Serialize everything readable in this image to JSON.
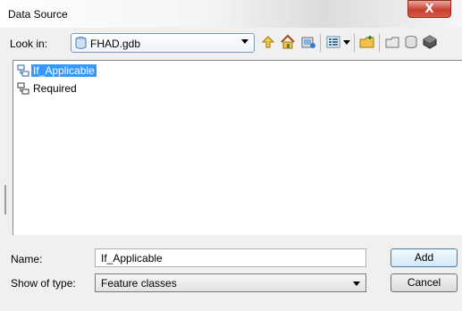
{
  "window": {
    "title": "Data Source",
    "close_glyph": "X"
  },
  "lookin": {
    "label": "Look in:",
    "value": "FHAD.gdb",
    "icon": "geodatabase-icon"
  },
  "toolbar": {
    "icons": [
      "up-one-level-icon",
      "home-icon",
      "catalog-connect-icon",
      "list-view-icon",
      "view-menu-arrow-icon",
      "new-folder-icon",
      "new-file-geodatabase-icon",
      "new-personal-geodatabase-icon",
      "arcsde-connection-icon"
    ]
  },
  "files": [
    {
      "label": "If_Applicable",
      "icon": "feature-dataset-icon",
      "selected": true
    },
    {
      "label": "Required",
      "icon": "feature-dataset-icon",
      "selected": false
    }
  ],
  "name_field": {
    "label": "Name:",
    "value": "If_Applicable"
  },
  "type_field": {
    "label": "Show of type:",
    "value": "Feature classes"
  },
  "buttons": {
    "add": "Add",
    "cancel": "Cancel"
  },
  "colors": {
    "selection": "#3399ff",
    "close_button": "#c8402e"
  }
}
